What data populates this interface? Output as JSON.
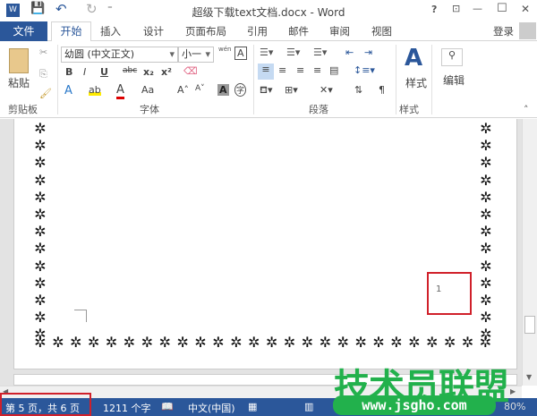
{
  "window": {
    "title": "超级下载text文档.docx - Word",
    "help": "?",
    "restore_ribbon": "⊡",
    "minimize": "—",
    "maximize": "☐",
    "close": "✕"
  },
  "qat": {
    "word_icon": "W",
    "save": "💾",
    "undo": "↶",
    "redo": "↻",
    "customize": "⁼"
  },
  "tabs": {
    "file": "文件",
    "items": [
      "开始",
      "插入",
      "设计",
      "页面布局",
      "引用",
      "邮件",
      "审阅",
      "视图"
    ],
    "login": "登录"
  },
  "ribbon": {
    "clipboard": {
      "paste": "粘贴",
      "label": "剪贴板"
    },
    "font": {
      "name": "幼圆 (中文正文)",
      "size": "小一",
      "bold": "B",
      "italic": "I",
      "underline": "U",
      "strike": "abc",
      "sub": "x₂",
      "sup": "x²",
      "font_color": "A",
      "highlight": "ab",
      "change_case": "Aa",
      "grow": "A˄",
      "shrink": "A˅",
      "char_shading": "A",
      "enclose": "字",
      "phonetic": "wén",
      "char_border": "A",
      "label": "字体"
    },
    "paragraph": {
      "label": "段落"
    },
    "styles": {
      "button": "样式",
      "label": "样式"
    },
    "editing": {
      "button": "编辑"
    }
  },
  "document": {
    "page_number_mark": "1"
  },
  "status": {
    "page": "第 5 页，共 6 页",
    "words": "1211 个字",
    "language": "中文(中国)",
    "zoom": "80%"
  },
  "watermark": {
    "title": "技术员联盟",
    "url": "www.jsgho.com"
  },
  "colors": {
    "accent": "#2b579a",
    "watermark": "#22b14c",
    "highlight_box": "#d0202a"
  }
}
